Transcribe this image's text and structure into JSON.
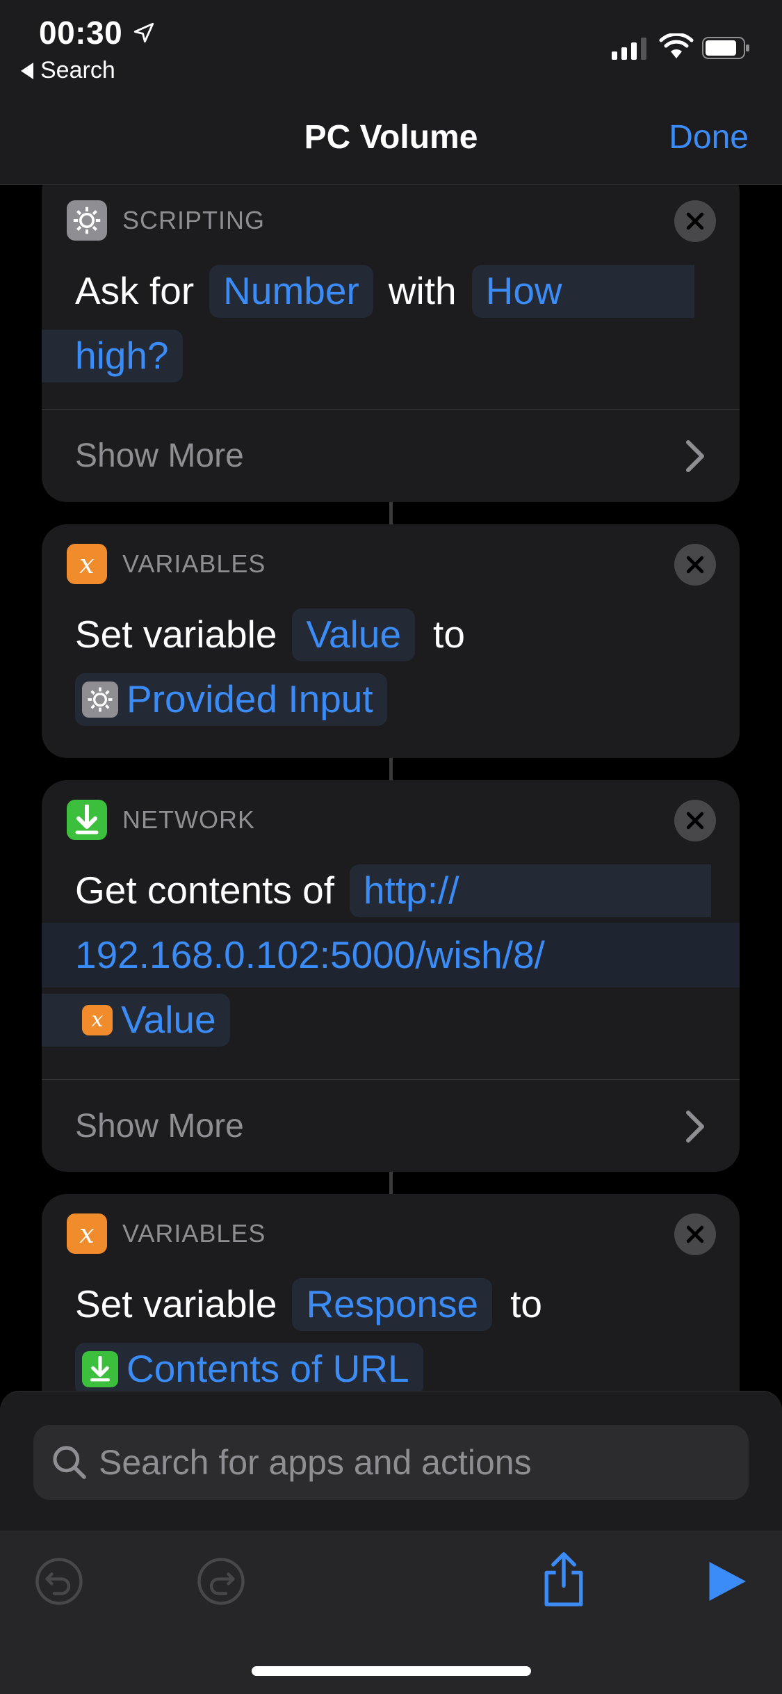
{
  "status_bar": {
    "time": "00:30",
    "back_label": "Search"
  },
  "nav": {
    "title": "PC Volume",
    "done_label": "Done"
  },
  "actions": [
    {
      "category": "SCRIPTING",
      "text": {
        "ask_for": "Ask for",
        "number_token": "Number",
        "with": "with",
        "how_token_1": "How",
        "how_token_2": "high?"
      },
      "show_more": "Show More"
    },
    {
      "category": "VARIABLES",
      "text": {
        "set_variable": "Set variable",
        "value_token": "Value",
        "to": "to",
        "input_token": "Provided Input"
      }
    },
    {
      "category": "NETWORK",
      "text": {
        "get_contents_of": "Get contents of",
        "url_1": "http://",
        "url_2": "192.168.0.102:5000/wish/8/",
        "value_token": "Value"
      },
      "show_more": "Show More"
    },
    {
      "category": "VARIABLES",
      "text": {
        "set_variable": "Set variable",
        "response_token": "Response",
        "to": "to",
        "contents_token": "Contents of URL"
      }
    }
  ],
  "search": {
    "placeholder": "Search for apps and actions"
  },
  "icons": {
    "scripting": "gear-icon",
    "variables": "variable-x-icon",
    "network": "download-arrow-icon",
    "close": "close-icon",
    "undo": "undo-icon",
    "redo": "redo-icon",
    "share": "share-icon",
    "play": "play-icon"
  },
  "colors": {
    "accent": "#3b8cf6",
    "variables_orange": "#f08c2c",
    "network_green": "#3cbf3c",
    "scripting_gray": "#8e8e93",
    "card_bg": "#1c1c1e"
  }
}
